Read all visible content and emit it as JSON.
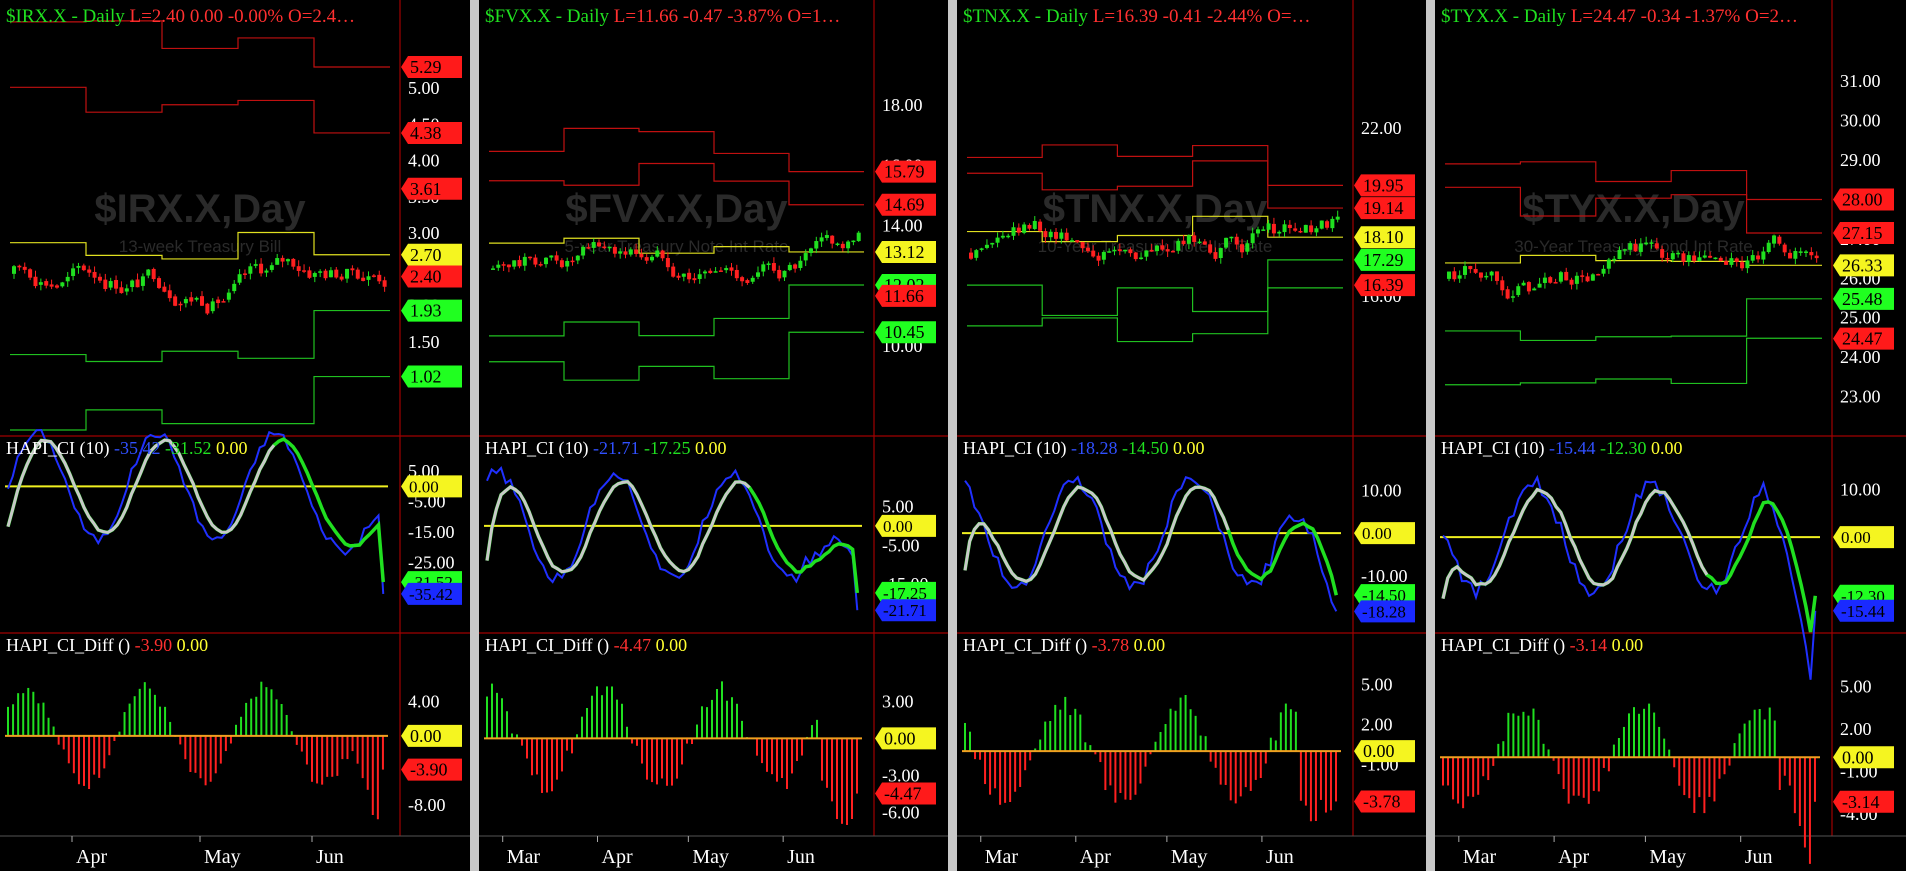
{
  "colors": {
    "bg": "#000000",
    "green": "#20e020",
    "red": "#ff2020",
    "yellow": "#f0f020",
    "blue": "#2030ff",
    "silver": "#c8c8c8",
    "grid": "#333333",
    "axis": "#a00000"
  },
  "panels": [
    {
      "id": "irx",
      "header": {
        "symbol": "$IRX.X - Daily",
        "last": "L=2.40",
        "chg": "0.00",
        "pct": "-0.00%",
        "open": "O=2.4…"
      },
      "watermark": {
        "title": "$IRX.X,Day",
        "subtitle": "13-week Treasury Bill"
      },
      "price_ticks": [
        "5.00",
        "4.50",
        "4.00",
        "3.50",
        "3.00",
        "2.50",
        "2.00",
        "1.50",
        "1.00"
      ],
      "price_range": [
        0.2,
        5.8
      ],
      "price_tags": [
        {
          "t": "5.29",
          "v": 5.29,
          "c": "red"
        },
        {
          "t": "4.38",
          "v": 4.38,
          "c": "red"
        },
        {
          "t": "3.61",
          "v": 3.61,
          "c": "red"
        },
        {
          "t": "2.70",
          "v": 2.7,
          "c": "yellow"
        },
        {
          "t": "2.40",
          "v": 2.4,
          "c": "red"
        },
        {
          "t": "1.93",
          "v": 1.93,
          "c": "green"
        },
        {
          "t": "1.02",
          "v": 1.02,
          "c": "green"
        }
      ],
      "ci": {
        "label": "HAPI_CI (10)",
        "v1": "-35.42",
        "v2": "-31.52",
        "v3": "0.00",
        "ticks": [
          "5.00",
          "-5.00",
          "-15.00",
          "-25.00"
        ],
        "range": [
          -45,
          10
        ],
        "tags": [
          {
            "t": "0.00",
            "v": 0,
            "c": "yellow"
          },
          {
            "t": "-31.52",
            "v": -31.52,
            "c": "green"
          },
          {
            "t": "-35.42",
            "v": -35.42,
            "c": "blue"
          }
        ]
      },
      "diff": {
        "label": "HAPI_CI_Diff ()",
        "v1": "-3.90",
        "v2": "0.00",
        "ticks": [
          "4.00",
          "0.00",
          "-8.00"
        ],
        "range": [
          -11,
          9
        ],
        "tags": [
          {
            "t": "0.00",
            "v": 0,
            "c": "yellow"
          },
          {
            "t": "-3.90",
            "v": -3.9,
            "c": "red"
          }
        ]
      },
      "months": [
        "Apr",
        "May",
        "Jun"
      ]
    },
    {
      "id": "fvx",
      "header": {
        "symbol": "$FVX.X - Daily",
        "last": "L=11.66",
        "chg": "-0.47",
        "pct": "-3.87%",
        "open": "O=1…"
      },
      "watermark": {
        "title": "$FVX.X,Day",
        "subtitle": "5-year Treasury Note Int Rate"
      },
      "price_ticks": [
        "18.00",
        "16.00",
        "14.00",
        "12.00",
        "10.00"
      ],
      "price_range": [
        7.0,
        20.5
      ],
      "price_tags": [
        {
          "t": "15.79",
          "v": 15.79,
          "c": "red"
        },
        {
          "t": "14.69",
          "v": 14.69,
          "c": "red"
        },
        {
          "t": "13.12",
          "v": 13.12,
          "c": "yellow"
        },
        {
          "t": "12.02",
          "v": 12.02,
          "c": "green"
        },
        {
          "t": "11.66",
          "v": 11.66,
          "c": "red"
        },
        {
          "t": "10.45",
          "v": 10.45,
          "c": "green"
        }
      ],
      "ci": {
        "label": "HAPI_CI (10)",
        "v1": "-21.71",
        "v2": "-17.25",
        "v3": "0.00",
        "ticks": [
          "5.00",
          "-5.00",
          "-15.00"
        ],
        "range": [
          -25,
          18
        ],
        "tags": [
          {
            "t": "0.00",
            "v": 0,
            "c": "yellow"
          },
          {
            "t": "-17.25",
            "v": -17.25,
            "c": "green"
          },
          {
            "t": "-21.71",
            "v": -21.71,
            "c": "blue"
          }
        ]
      },
      "diff": {
        "label": "HAPI_CI_Diff ()",
        "v1": "-4.47",
        "v2": "0.00",
        "ticks": [
          "3.00",
          "0.00",
          "-3.00",
          "-6.00"
        ],
        "range": [
          -7.5,
          6.5
        ],
        "tags": [
          {
            "t": "0.00",
            "v": 0,
            "c": "yellow"
          },
          {
            "t": "-4.47",
            "v": -4.47,
            "c": "red"
          }
        ]
      },
      "months": [
        "Mar",
        "Apr",
        "May",
        "Jun"
      ]
    },
    {
      "id": "tnx",
      "header": {
        "symbol": "$TNX.X - Daily",
        "last": "L=16.39",
        "chg": "-0.41",
        "pct": "-2.44%",
        "open": "O=…"
      },
      "watermark": {
        "title": "$TNX.X,Day",
        "subtitle": "10-Year Treasury Note Int Rate"
      },
      "price_ticks": [
        "22.00",
        "16.00"
      ],
      "price_range": [
        11.0,
        25.5
      ],
      "price_tags": [
        {
          "t": "19.95",
          "v": 19.95,
          "c": "red"
        },
        {
          "t": "19.14",
          "v": 19.14,
          "c": "red"
        },
        {
          "t": "18.10",
          "v": 18.1,
          "c": "yellow"
        },
        {
          "t": "17.29",
          "v": 17.29,
          "c": "green"
        },
        {
          "t": "16.39",
          "v": 16.39,
          "c": "red"
        }
      ],
      "ci": {
        "label": "HAPI_CI (10)",
        "v1": "-18.28",
        "v2": "-14.50",
        "v3": "0.00",
        "ticks": [
          "10.00",
          "0.00",
          "-10.00"
        ],
        "range": [
          -21,
          18
        ],
        "tags": [
          {
            "t": "0.00",
            "v": 0,
            "c": "yellow"
          },
          {
            "t": "-14.50",
            "v": -14.5,
            "c": "green"
          },
          {
            "t": "-18.28",
            "v": -18.28,
            "c": "blue"
          }
        ]
      },
      "diff": {
        "label": "HAPI_CI_Diff ()",
        "v1": "-3.78",
        "v2": "0.00",
        "ticks": [
          "5.00",
          "2.00",
          "-1.00"
        ],
        "range": [
          -6,
          7
        ],
        "tags": [
          {
            "t": "0.00",
            "v": 0,
            "c": "yellow"
          },
          {
            "t": "-3.78",
            "v": -3.78,
            "c": "red"
          }
        ]
      },
      "months": [
        "Mar",
        "Apr",
        "May",
        "Jun"
      ]
    },
    {
      "id": "tyx",
      "header": {
        "symbol": "$TYX.X - Daily",
        "last": "L=24.47",
        "chg": "-0.34",
        "pct": "-1.37%",
        "open": "O=2…"
      },
      "watermark": {
        "title": "$TYX.X,Day",
        "subtitle": "30-Year Treasury Bond Int Rate"
      },
      "price_ticks": [
        "31.00",
        "30.00",
        "29.00",
        "28.00",
        "27.00",
        "26.00",
        "25.00",
        "24.00",
        "23.00"
      ],
      "price_range": [
        22.0,
        32.3
      ],
      "price_tags": [
        {
          "t": "28.00",
          "v": 28.0,
          "c": "red"
        },
        {
          "t": "27.15",
          "v": 27.15,
          "c": "red"
        },
        {
          "t": "26.33",
          "v": 26.33,
          "c": "yellow"
        },
        {
          "t": "25.48",
          "v": 25.48,
          "c": "green"
        },
        {
          "t": "24.47",
          "v": 24.47,
          "c": "red"
        }
      ],
      "ci": {
        "label": "HAPI_CI (10)",
        "v1": "-15.44",
        "v2": "-12.30",
        "v3": "0.00",
        "ticks": [
          "10.00",
          "0.00"
        ],
        "range": [
          -18,
          17
        ],
        "tags": [
          {
            "t": "0.00",
            "v": 0,
            "c": "yellow"
          },
          {
            "t": "-12.30",
            "v": -12.3,
            "c": "green"
          },
          {
            "t": "-15.44",
            "v": -15.44,
            "c": "blue"
          }
        ]
      },
      "diff": {
        "label": "HAPI_CI_Diff ()",
        "v1": "-3.14",
        "v2": "0.00",
        "ticks": [
          "5.00",
          "2.00",
          "-1.00",
          "-4.00"
        ],
        "range": [
          -5.2,
          7
        ],
        "tags": [
          {
            "t": "0.00",
            "v": 0,
            "c": "yellow"
          },
          {
            "t": "-3.14",
            "v": -3.14,
            "c": "red"
          }
        ]
      },
      "months": [
        "Mar",
        "Apr",
        "May",
        "Jun"
      ]
    }
  ],
  "chart_data": [
    {
      "type": "line",
      "title": "$IRX.X - Daily",
      "series": [
        {
          "name": "HAPI_CI (10)",
          "values": [
            -35.42
          ]
        },
        {
          "name": "HAPI_CI_Diff ()",
          "values": [
            -3.9
          ]
        }
      ],
      "levels": [
        5.29,
        4.38,
        3.61,
        2.7,
        2.4,
        1.93,
        1.02
      ],
      "x": [
        "Apr",
        "May",
        "Jun"
      ]
    },
    {
      "type": "line",
      "title": "$FVX.X - Daily",
      "series": [
        {
          "name": "HAPI_CI (10)",
          "values": [
            -21.71
          ]
        },
        {
          "name": "HAPI_CI_Diff ()",
          "values": [
            -4.47
          ]
        }
      ],
      "levels": [
        15.79,
        14.69,
        13.12,
        12.02,
        11.66,
        10.45
      ],
      "x": [
        "Mar",
        "Apr",
        "May",
        "Jun"
      ]
    },
    {
      "type": "line",
      "title": "$TNX.X - Daily",
      "series": [
        {
          "name": "HAPI_CI (10)",
          "values": [
            -18.28
          ]
        },
        {
          "name": "HAPI_CI_Diff ()",
          "values": [
            -3.78
          ]
        }
      ],
      "levels": [
        19.95,
        19.14,
        18.1,
        17.29,
        16.39
      ],
      "x": [
        "Mar",
        "Apr",
        "May",
        "Jun"
      ]
    },
    {
      "type": "line",
      "title": "$TYX.X - Daily",
      "series": [
        {
          "name": "HAPI_CI (10)",
          "values": [
            -15.44
          ]
        },
        {
          "name": "HAPI_CI_Diff ()",
          "values": [
            -3.14
          ]
        }
      ],
      "levels": [
        28.0,
        27.15,
        26.33,
        25.48,
        24.47
      ],
      "x": [
        "Mar",
        "Apr",
        "May",
        "Jun"
      ]
    }
  ]
}
